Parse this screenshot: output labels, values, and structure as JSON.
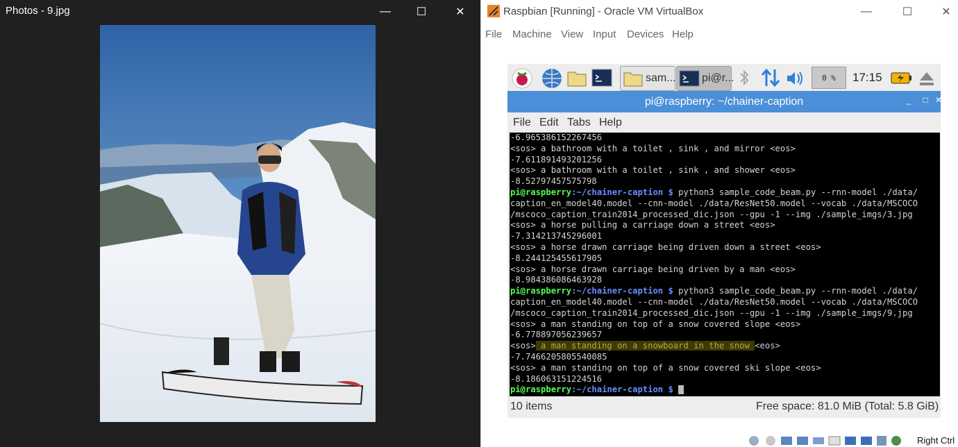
{
  "photos_window": {
    "title": "Photos - 9.jpg",
    "controls": {
      "minimize": "—",
      "maximize": "☐",
      "close": "✕"
    }
  },
  "vbox_window": {
    "title": "Raspbian [Running] - Oracle VM VirtualBox",
    "controls": {
      "minimize": "—",
      "maximize": "☐",
      "close": "✕"
    },
    "menu": [
      "File",
      "Machine",
      "View",
      "Input",
      "Devices",
      "Help"
    ]
  },
  "panel": {
    "tasks": [
      {
        "label": "sam...",
        "icon": "folder-icon"
      },
      {
        "label": "pi@r...",
        "icon": "terminal-icon"
      }
    ],
    "cpu": "0 %",
    "clock": "17:15"
  },
  "terminal": {
    "title": "pi@raspberry: ~/chainer-caption",
    "controls": {
      "minimize": "_",
      "maximize": "□",
      "close": "✕"
    },
    "menu": [
      "File",
      "Edit",
      "Tabs",
      "Help"
    ],
    "prompt_user": "pi@raspberry",
    "prompt_path": ":~/chainer-caption $ ",
    "lines": [
      "-6.965386152267456",
      "<sos> a bathroom with a toilet , sink , and mirror <eos>",
      "-7.611891493201256",
      "<sos> a bathroom with a toilet , sink , and shower <eos>",
      "-8.52797457575798"
    ],
    "cmd1": [
      "python3 sample_code_beam.py --rnn-model ./data/",
      "caption_en_model40.model --cnn-model ./data/ResNet50.model --vocab ./data/MSCOCO",
      "/mscoco_caption_train2014_processed_dic.json --gpu -1 --img ./sample_imgs/3.jpg"
    ],
    "out1": [
      "<sos> a horse pulling a carriage down a street <eos>",
      "-7.314213745296001",
      "<sos> a horse drawn carriage being driven down a street <eos>",
      "-8.244125455617905",
      "<sos> a horse drawn carriage being driven by a man <eos>",
      "-8.984386086463928"
    ],
    "cmd2": [
      "python3 sample_code_beam.py --rnn-model ./data/",
      "caption_en_model40.model --cnn-model ./data/ResNet50.model --vocab ./data/MSCOCO",
      "/mscoco_caption_train2014_processed_dic.json --gpu -1 --img ./sample_imgs/9.jpg"
    ],
    "out2a": [
      "<sos> a man standing on top of a snow covered slope <eos>",
      "-6.778897056239657"
    ],
    "hl_pre": "<sos>",
    "hl_text": " a man standing on a snowboard in the snow ",
    "hl_post": "<eos>",
    "out2b": [
      "-7.7466205805540085",
      "<sos> a man standing on top of a snow covered ski slope <eos>",
      "-8.186063151224516"
    ]
  },
  "file_manager_status": {
    "items": "10 items",
    "free_space": "Free space: 81.0 MiB (Total: 5.8 GiB)"
  },
  "host_status": {
    "key": "Right Ctrl"
  }
}
